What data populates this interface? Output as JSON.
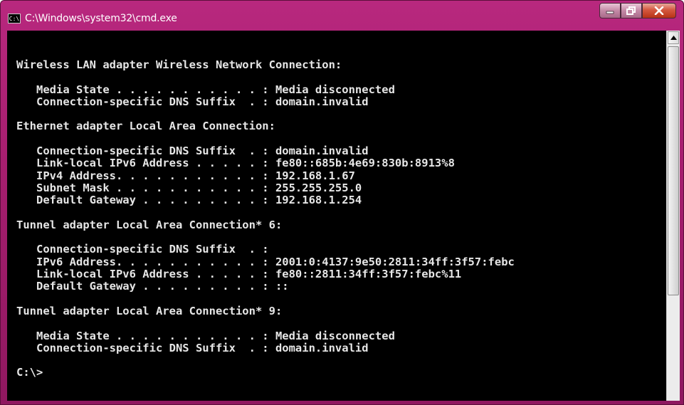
{
  "window": {
    "title": "C:\\Windows\\system32\\cmd.exe",
    "icon_text": "C:\\"
  },
  "controls": [
    "minimize-icon",
    "maximize-icon",
    "close-icon"
  ],
  "colors": {
    "frame": "#a61e6f",
    "console_bg": "#000000",
    "console_text": "#e6e6e6",
    "close": "#c9391d"
  },
  "console": {
    "lines": [
      "Wireless LAN adapter Wireless Network Connection:",
      "",
      "   Media State . . . . . . . . . . . : Media disconnected",
      "   Connection-specific DNS Suffix  . : domain.invalid",
      "",
      "Ethernet adapter Local Area Connection:",
      "",
      "   Connection-specific DNS Suffix  . : domain.invalid",
      "   Link-local IPv6 Address . . . . . : fe80::685b:4e69:830b:8913%8",
      "   IPv4 Address. . . . . . . . . . . : 192.168.1.67",
      "   Subnet Mask . . . . . . . . . . . : 255.255.255.0",
      "   Default Gateway . . . . . . . . . : 192.168.1.254",
      "",
      "Tunnel adapter Local Area Connection* 6:",
      "",
      "   Connection-specific DNS Suffix  . :",
      "   IPv6 Address. . . . . . . . . . . : 2001:0:4137:9e50:2811:34ff:3f57:febc",
      "   Link-local IPv6 Address . . . . . : fe80::2811:34ff:3f57:febc%11",
      "   Default Gateway . . . . . . . . . : ::",
      "",
      "Tunnel adapter Local Area Connection* 9:",
      "",
      "   Media State . . . . . . . . . . . : Media disconnected",
      "   Connection-specific DNS Suffix  . : domain.invalid",
      "",
      "C:\\>"
    ]
  }
}
